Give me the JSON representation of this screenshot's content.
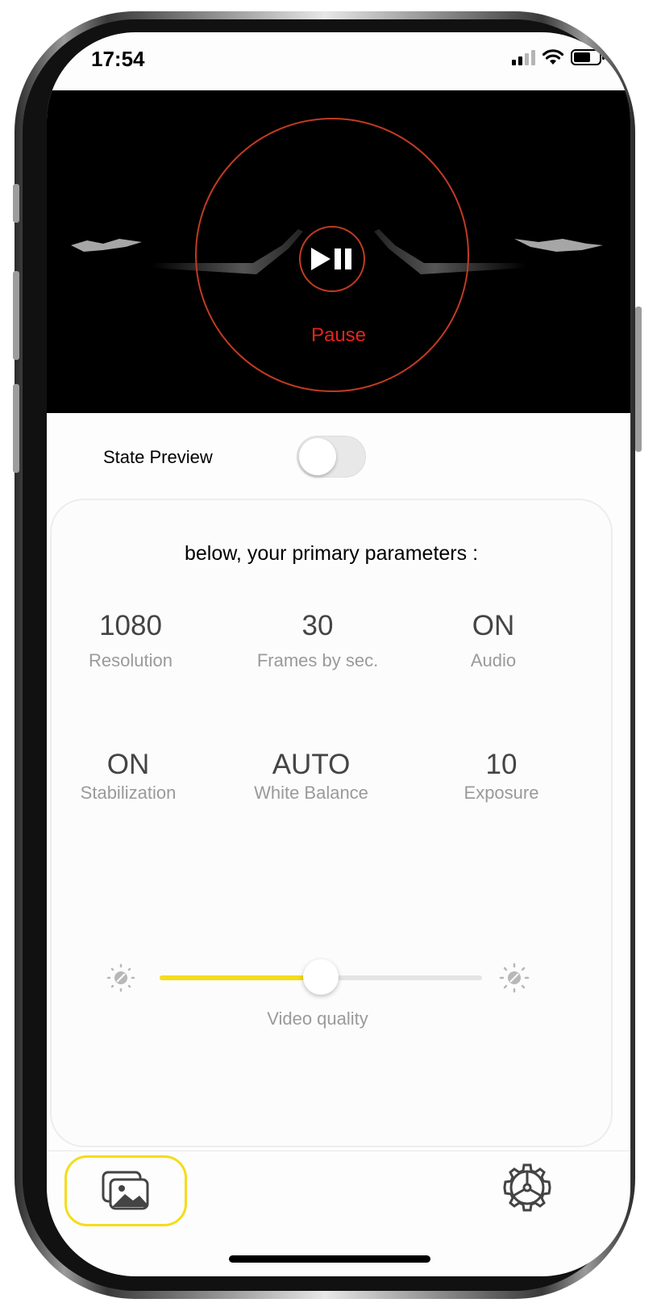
{
  "status_bar": {
    "time": "17:54"
  },
  "video": {
    "state_label": "Pause"
  },
  "preview_toggle": {
    "label": "State Preview",
    "on": false
  },
  "parameters": {
    "heading": "below, your primary parameters :",
    "items": [
      {
        "value": "1080",
        "label": "Resolution"
      },
      {
        "value": "30",
        "label": "Frames by sec."
      },
      {
        "value": "ON",
        "label": "Audio"
      },
      {
        "value": "ON",
        "label": "Stabilization"
      },
      {
        "value": "AUTO",
        "label": "White Balance"
      },
      {
        "value": "10",
        "label": "Exposure"
      }
    ]
  },
  "video_quality": {
    "label": "Video quality",
    "value_fraction": 0.5
  },
  "tabbar": {
    "left_icon": "gallery-icon",
    "right_icon": "settings-gear-icon"
  },
  "colors": {
    "accent_yellow": "#f5dc1a",
    "pause_red": "#e5241d",
    "ring_red": "#c23a24"
  }
}
